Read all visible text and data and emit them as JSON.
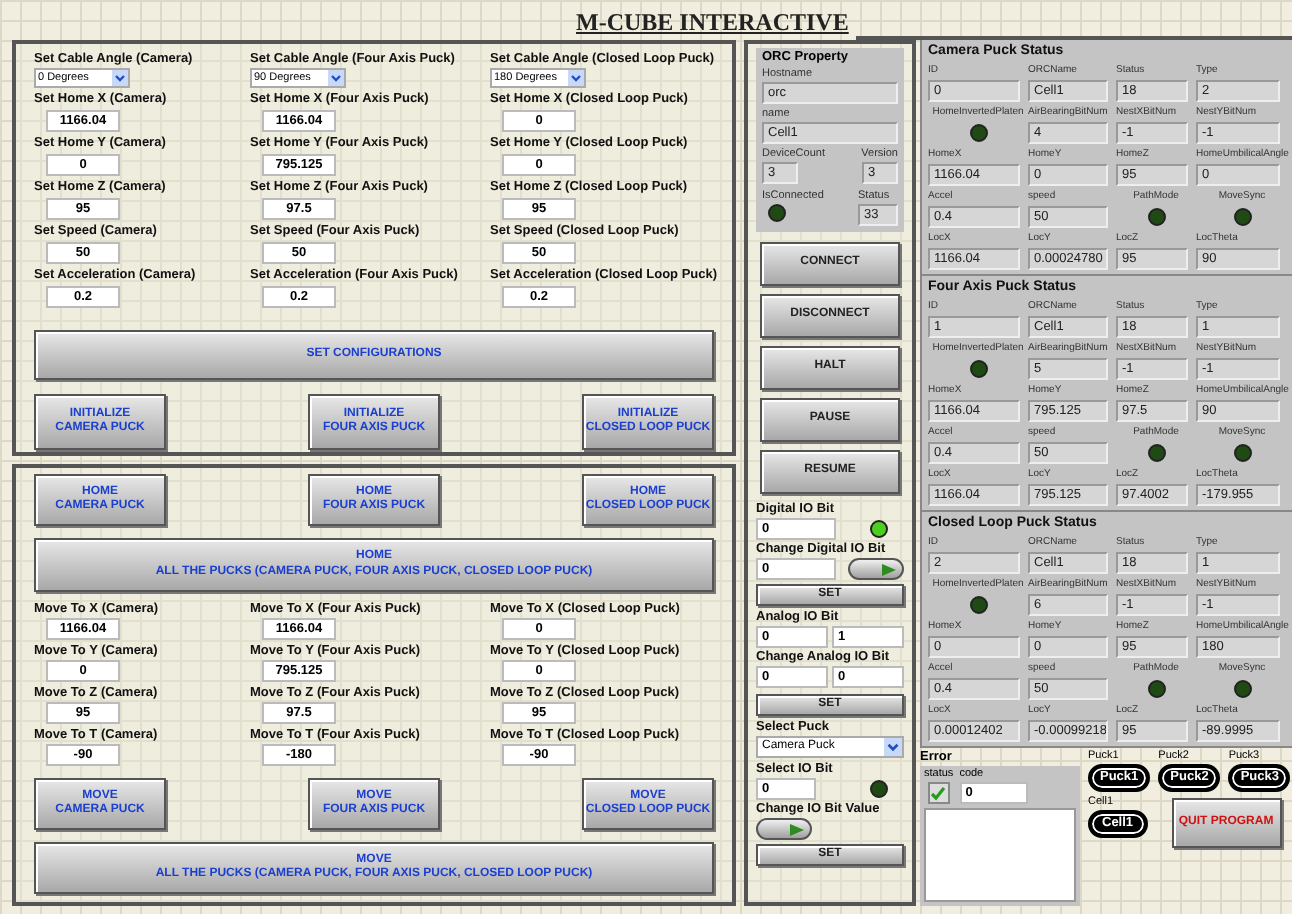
{
  "title": "M-CUBE INTERACTIVE",
  "config": {
    "columns": [
      {
        "angle_label": "Set Cable Angle (Camera)",
        "angle_value": "0 Degrees",
        "fields": [
          {
            "label": "Set Home X (Camera)",
            "value": "1166.04"
          },
          {
            "label": "Set Home Y (Camera)",
            "value": "0"
          },
          {
            "label": "Set Home Z (Camera)",
            "value": "95"
          },
          {
            "label": "Set Speed (Camera)",
            "value": "50"
          },
          {
            "label": "Set Acceleration (Camera)",
            "value": "0.2"
          }
        ]
      },
      {
        "angle_label": "Set Cable Angle (Four Axis Puck)",
        "angle_value": "90 Degrees",
        "fields": [
          {
            "label": "Set Home X (Four Axis Puck)",
            "value": "1166.04"
          },
          {
            "label": "Set Home Y (Four Axis Puck)",
            "value": "795.125"
          },
          {
            "label": "Set Home Z (Four Axis Puck)",
            "value": "97.5"
          },
          {
            "label": "Set Speed (Four Axis Puck)",
            "value": "50"
          },
          {
            "label": "Set Acceleration (Four Axis Puck)",
            "value": "0.2"
          }
        ]
      },
      {
        "angle_label": "Set Cable Angle (Closed Loop Puck)",
        "angle_value": "180 Degrees",
        "fields": [
          {
            "label": "Set Home X (Closed Loop Puck)",
            "value": "0"
          },
          {
            "label": "Set Home Y (Closed Loop Puck)",
            "value": "0"
          },
          {
            "label": "Set Home Z (Closed Loop Puck)",
            "value": "95"
          },
          {
            "label": "Set Speed (Closed Loop Puck)",
            "value": "50"
          },
          {
            "label": "Set Acceleration (Closed Loop Puck)",
            "value": "0.2"
          }
        ]
      }
    ],
    "set_button": "SET CONFIGURATIONS",
    "init_buttons": [
      [
        "INITIALIZE",
        "CAMERA PUCK"
      ],
      [
        "INITIALIZE",
        "FOUR AXIS PUCK"
      ],
      [
        "INITIALIZE",
        "CLOSED LOOP PUCK"
      ]
    ]
  },
  "motion": {
    "home_buttons": [
      [
        "HOME",
        "CAMERA PUCK"
      ],
      [
        "HOME",
        "FOUR AXIS PUCK"
      ],
      [
        "HOME",
        "CLOSED LOOP PUCK"
      ]
    ],
    "home_all": [
      "HOME",
      "ALL THE PUCKS (CAMERA PUCK, FOUR AXIS PUCK, CLOSED LOOP PUCK)"
    ],
    "move_columns": [
      [
        {
          "label": "Move To X (Camera)",
          "value": "1166.04"
        },
        {
          "label": "Move To Y (Camera)",
          "value": "0"
        },
        {
          "label": "Move To Z (Camera)",
          "value": "95"
        },
        {
          "label": "Move To T (Camera)",
          "value": "-90"
        }
      ],
      [
        {
          "label": "Move To X (Four Axis Puck)",
          "value": "1166.04"
        },
        {
          "label": "Move To Y (Four Axis Puck)",
          "value": "795.125"
        },
        {
          "label": "Move To Z (Four Axis Puck)",
          "value": "97.5"
        },
        {
          "label": "Move To T (Four Axis Puck)",
          "value": "-180"
        }
      ],
      [
        {
          "label": "Move To X (Closed Loop Puck)",
          "value": "0"
        },
        {
          "label": "Move To Y (Closed Loop Puck)",
          "value": "0"
        },
        {
          "label": "Move To Z (Closed Loop Puck)",
          "value": "95"
        },
        {
          "label": "Move To T (Closed Loop Puck)",
          "value": "-90"
        }
      ]
    ],
    "move_buttons": [
      [
        "MOVE",
        "CAMERA PUCK"
      ],
      [
        "MOVE",
        "FOUR AXIS PUCK"
      ],
      [
        "MOVE",
        "CLOSED LOOP PUCK"
      ]
    ],
    "move_all": [
      "MOVE",
      "ALL THE PUCKS (CAMERA PUCK, FOUR AXIS PUCK, CLOSED LOOP PUCK)"
    ]
  },
  "orc": {
    "title": "ORC Property",
    "hostname_label": "Hostname",
    "hostname": "orc",
    "name_label": "name",
    "name": "Cell1",
    "device_count_label": "DeviceCount",
    "device_count": "3",
    "version_label": "Version",
    "version": "3",
    "connected_label": "IsConnected",
    "connected": false,
    "status_label": "Status",
    "status": "33",
    "buttons": [
      "CONNECT",
      "DISCONNECT",
      "HALT",
      "PAUSE",
      "RESUME"
    ],
    "digital_label": "Digital IO Bit",
    "digital_value": "0",
    "digital_on": true,
    "change_digital_label": "Change Digital IO Bit",
    "change_digital_value": "0",
    "change_digital_on": true,
    "set1": "SET",
    "analog_label": "Analog IO Bit",
    "analog_values": [
      "0",
      "1"
    ],
    "change_analog_label": "Change Analog IO Bit",
    "change_analog_values": [
      "0",
      "0"
    ],
    "set2": "SET",
    "select_puck_label": "Select Puck",
    "select_puck": "Camera Puck",
    "select_bit_label": "Select IO Bit",
    "select_bit": "0",
    "select_bit_on": false,
    "change_bit_label": "Change IO Bit Value",
    "change_bit_on": true,
    "set3": "SET"
  },
  "statuses": [
    {
      "title": "Camera Puck Status",
      "rows": [
        [
          {
            "kind": "field",
            "label": "ID",
            "value": "0"
          },
          {
            "kind": "field",
            "label": "ORCName",
            "value": "Cell1"
          },
          {
            "kind": "field",
            "label": "Status",
            "value": "18"
          },
          {
            "kind": "field",
            "label": "Type",
            "value": "2"
          }
        ],
        [
          {
            "kind": "led",
            "label": "HomeInvertedPlaten",
            "on": false
          },
          {
            "kind": "field",
            "label": "AirBearingBitNum",
            "value": "4"
          },
          {
            "kind": "field",
            "label": "NestXBitNum",
            "value": "-1"
          },
          {
            "kind": "field",
            "label": "NestYBitNum",
            "value": "-1"
          }
        ],
        [
          {
            "kind": "field",
            "label": "HomeX",
            "value": "1166.04"
          },
          {
            "kind": "field",
            "label": "HomeY",
            "value": "0"
          },
          {
            "kind": "field",
            "label": "HomeZ",
            "value": "95"
          },
          {
            "kind": "field",
            "label": "HomeUmbilicalAngle",
            "value": "0"
          }
        ],
        [
          {
            "kind": "field",
            "label": "Accel",
            "value": "0.4"
          },
          {
            "kind": "field",
            "label": "speed",
            "value": "50"
          },
          {
            "kind": "led",
            "label": "PathMode",
            "on": false
          },
          {
            "kind": "led",
            "label": "MoveSync",
            "on": false
          }
        ],
        [
          {
            "kind": "field",
            "label": "LocX",
            "value": "1166.04"
          },
          {
            "kind": "field",
            "label": "LocY",
            "value": "0.00024780"
          },
          {
            "kind": "field",
            "label": "LocZ",
            "value": "95"
          },
          {
            "kind": "field",
            "label": "LocTheta",
            "value": "90"
          }
        ]
      ]
    },
    {
      "title": "Four Axis Puck Status",
      "rows": [
        [
          {
            "kind": "field",
            "label": "ID",
            "value": "1"
          },
          {
            "kind": "field",
            "label": "ORCName",
            "value": "Cell1"
          },
          {
            "kind": "field",
            "label": "Status",
            "value": "18"
          },
          {
            "kind": "field",
            "label": "Type",
            "value": "1"
          }
        ],
        [
          {
            "kind": "led",
            "label": "HomeInvertedPlaten",
            "on": false
          },
          {
            "kind": "field",
            "label": "AirBearingBitNum",
            "value": "5"
          },
          {
            "kind": "field",
            "label": "NestXBitNum",
            "value": "-1"
          },
          {
            "kind": "field",
            "label": "NestYBitNum",
            "value": "-1"
          }
        ],
        [
          {
            "kind": "field",
            "label": "HomeX",
            "value": "1166.04"
          },
          {
            "kind": "field",
            "label": "HomeY",
            "value": "795.125"
          },
          {
            "kind": "field",
            "label": "HomeZ",
            "value": "97.5"
          },
          {
            "kind": "field",
            "label": "HomeUmbilicalAngle",
            "value": "90"
          }
        ],
        [
          {
            "kind": "field",
            "label": "Accel",
            "value": "0.4"
          },
          {
            "kind": "field",
            "label": "speed",
            "value": "50"
          },
          {
            "kind": "led",
            "label": "PathMode",
            "on": false
          },
          {
            "kind": "led",
            "label": "MoveSync",
            "on": false
          }
        ],
        [
          {
            "kind": "field",
            "label": "LocX",
            "value": "1166.04"
          },
          {
            "kind": "field",
            "label": "LocY",
            "value": "795.125"
          },
          {
            "kind": "field",
            "label": "LocZ",
            "value": "97.4002"
          },
          {
            "kind": "field",
            "label": "LocTheta",
            "value": "-179.955"
          }
        ]
      ]
    },
    {
      "title": "Closed Loop Puck Status",
      "rows": [
        [
          {
            "kind": "field",
            "label": "ID",
            "value": "2"
          },
          {
            "kind": "field",
            "label": "ORCName",
            "value": "Cell1"
          },
          {
            "kind": "field",
            "label": "Status",
            "value": "18"
          },
          {
            "kind": "field",
            "label": "Type",
            "value": "1"
          }
        ],
        [
          {
            "kind": "led",
            "label": "HomeInvertedPlaten",
            "on": false
          },
          {
            "kind": "field",
            "label": "AirBearingBitNum",
            "value": "6"
          },
          {
            "kind": "field",
            "label": "NestXBitNum",
            "value": "-1"
          },
          {
            "kind": "field",
            "label": "NestYBitNum",
            "value": "-1"
          }
        ],
        [
          {
            "kind": "field",
            "label": "HomeX",
            "value": "0"
          },
          {
            "kind": "field",
            "label": "HomeY",
            "value": "0"
          },
          {
            "kind": "field",
            "label": "HomeZ",
            "value": "95"
          },
          {
            "kind": "field",
            "label": "HomeUmbilicalAngle",
            "value": "180"
          }
        ],
        [
          {
            "kind": "field",
            "label": "Accel",
            "value": "0.4"
          },
          {
            "kind": "field",
            "label": "speed",
            "value": "50"
          },
          {
            "kind": "led",
            "label": "PathMode",
            "on": false
          },
          {
            "kind": "led",
            "label": "MoveSync",
            "on": false
          }
        ],
        [
          {
            "kind": "field",
            "label": "LocX",
            "value": "0.00012402"
          },
          {
            "kind": "field",
            "label": "LocY",
            "value": "-0.00099218"
          },
          {
            "kind": "field",
            "label": "LocZ",
            "value": "95"
          },
          {
            "kind": "field",
            "label": "LocTheta",
            "value": "-89.9995"
          }
        ]
      ]
    }
  ],
  "error": {
    "title": "Error",
    "status_label": "status",
    "status_ok": true,
    "code_label": "code",
    "code": "0"
  },
  "pucks": [
    {
      "label": "Puck1",
      "name": "Puck1"
    },
    {
      "label": "Puck2",
      "name": "Puck2"
    },
    {
      "label": "Puck3",
      "name": "Puck3"
    }
  ],
  "cell": {
    "label": "Cell1",
    "name": "Cell1"
  },
  "quit_button": "QUIT PROGRAM"
}
